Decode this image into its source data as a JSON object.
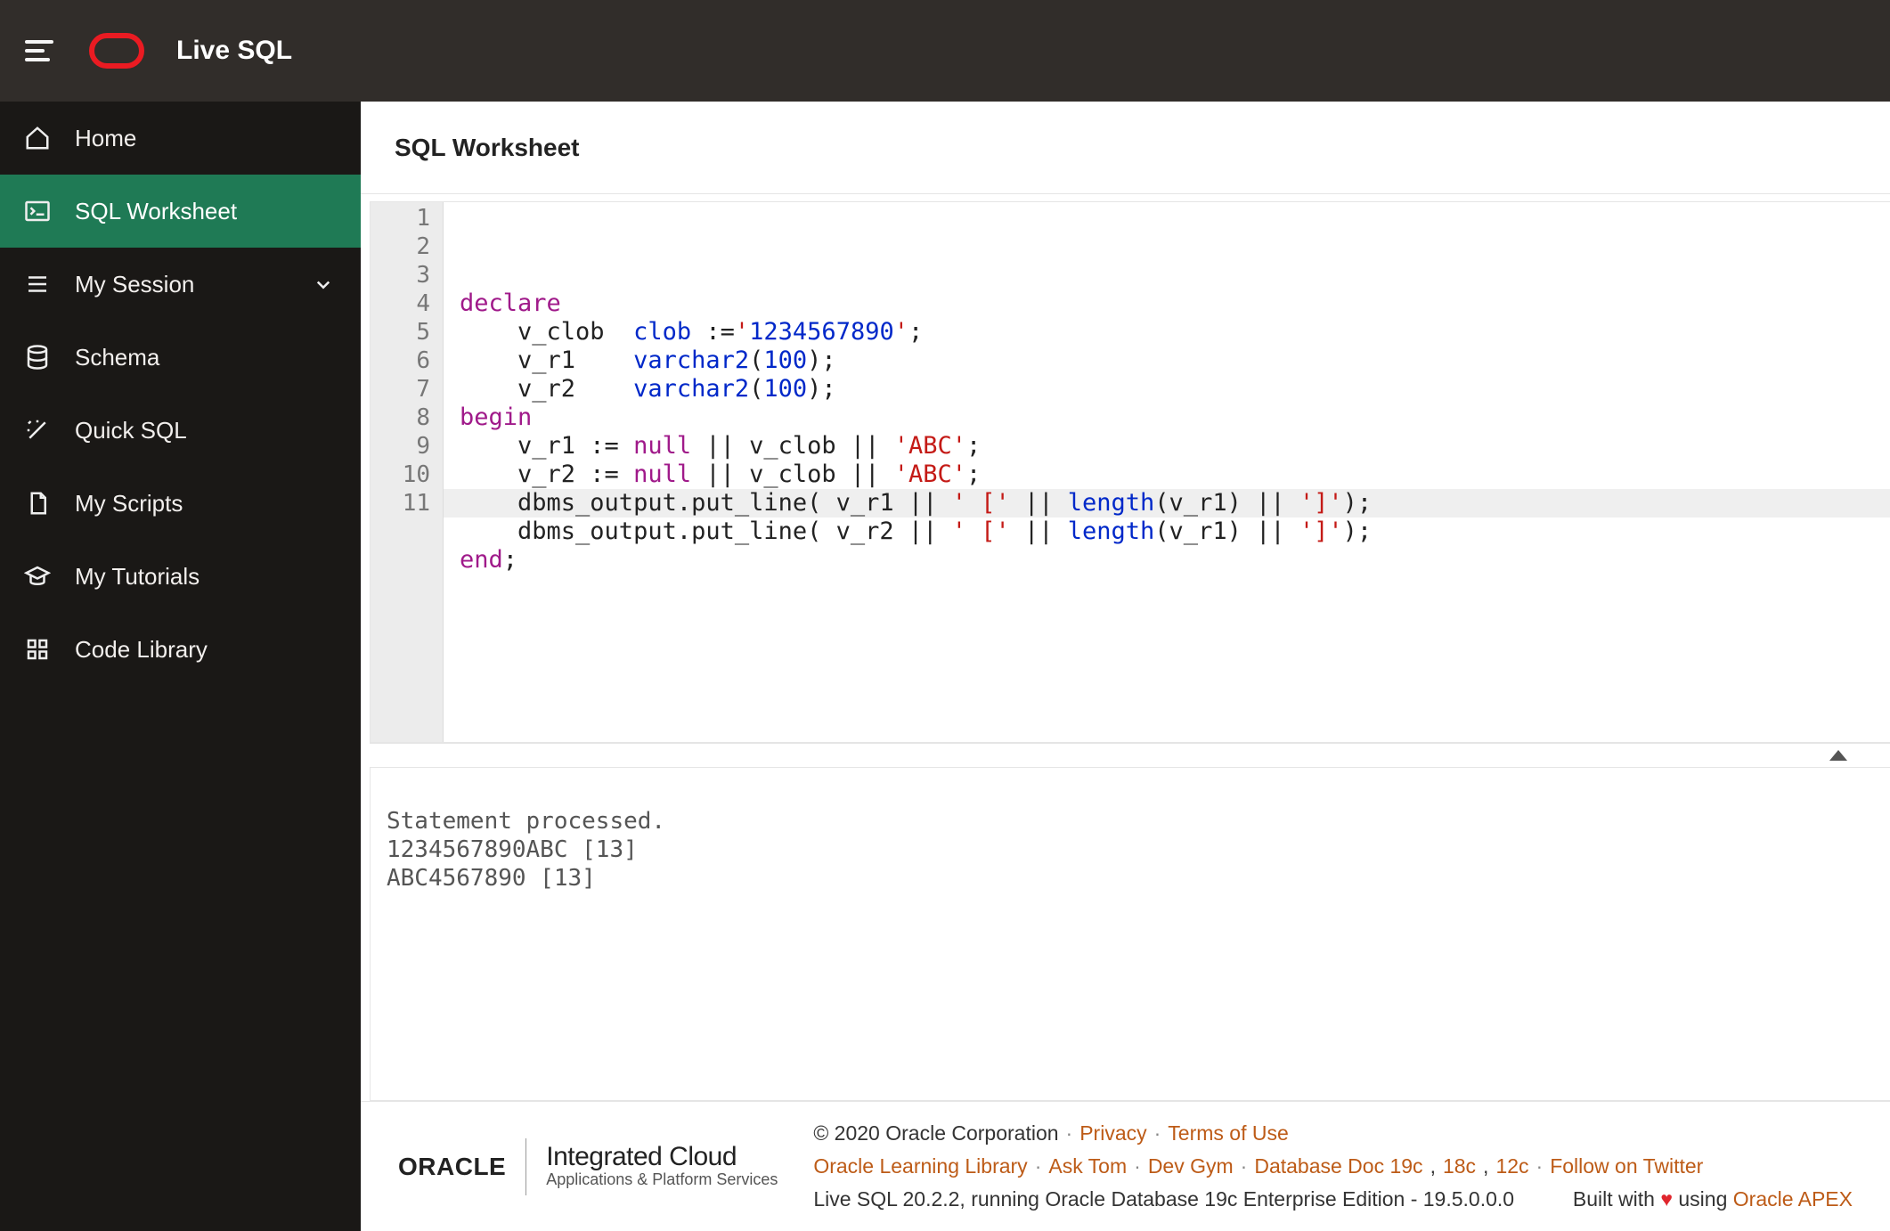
{
  "header": {
    "brand": "Live SQL"
  },
  "sidebar": {
    "items": [
      {
        "label": "Home"
      },
      {
        "label": "SQL Worksheet"
      },
      {
        "label": "My Session"
      },
      {
        "label": "Schema"
      },
      {
        "label": "Quick SQL"
      },
      {
        "label": "My Scripts"
      },
      {
        "label": "My Tutorials"
      },
      {
        "label": "Code Library"
      }
    ]
  },
  "page": {
    "title": "SQL Worksheet"
  },
  "editor": {
    "line_numbers": [
      "1",
      "2",
      "3",
      "4",
      "5",
      "6",
      "7",
      "8",
      "9",
      "10",
      "11"
    ],
    "lines_plain": [
      "declare",
      "    v_clob  clob :='1234567890';",
      "    v_r1    varchar2(100);",
      "    v_r2    varchar2(100);",
      "begin",
      "    v_r1 := null || v_clob || 'ABC';",
      "    v_r2 := null || v_clob || 'ABC';",
      "    dbms_output.put_line( v_r1 || ' [' || length(v_r1) || ']');",
      "    dbms_output.put_line( v_r2 || ' [' || length(v_r1) || ']');",
      "end;",
      ""
    ]
  },
  "output": {
    "text": "Statement processed.\n1234567890ABC [13]\nABC4567890 [13]"
  },
  "footer": {
    "logo_word": "ORACLE",
    "integrated_title": "Integrated Cloud",
    "integrated_sub": "Applications & Platform Services",
    "copyright": "© 2020 Oracle Corporation",
    "privacy": "Privacy",
    "terms": "Terms of Use",
    "links2": {
      "oll": "Oracle Learning Library",
      "asktom": "Ask Tom",
      "devgym": "Dev Gym",
      "doc19": "Database Doc 19c",
      "doc18": "18c",
      "doc12": "12c",
      "twitter": "Follow on Twitter"
    },
    "version": "Live SQL 20.2.2, running Oracle Database 19c Enterprise Edition - 19.5.0.0.0",
    "built_prefix": "Built with",
    "built_mid": "using",
    "apex": "Oracle APEX"
  }
}
